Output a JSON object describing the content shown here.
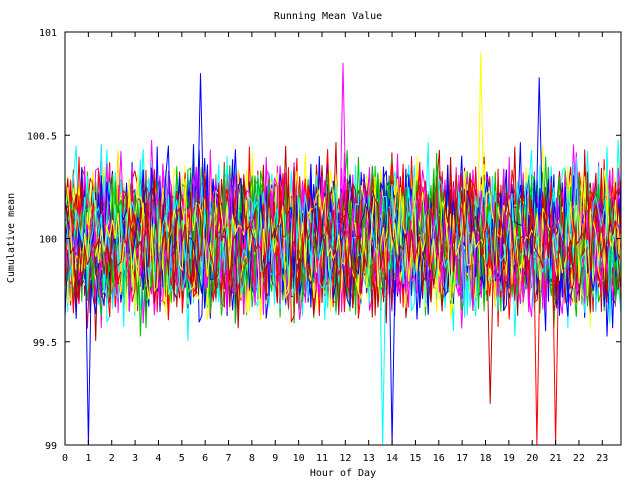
{
  "chart_data": {
    "type": "line",
    "title": "Running Mean Value",
    "xlabel": "Hour of Day",
    "ylabel": "Cumulative mean",
    "xlim": [
      0,
      23.8
    ],
    "ylim": [
      99,
      101
    ],
    "x_ticks": [
      "0",
      "1",
      "2",
      "3",
      "4",
      "5",
      "6",
      "7",
      "8",
      "9",
      "10",
      "11",
      "12",
      "13",
      "14",
      "15",
      "16",
      "17",
      "18",
      "19",
      "20",
      "21",
      "22",
      "23"
    ],
    "y_ticks": [
      "99",
      "99.5",
      "100",
      "100.5",
      "101"
    ],
    "grid": false,
    "legend": "none",
    "series_colors": [
      "#ff0000",
      "#00c000",
      "#0000ff",
      "#ff00ff",
      "#00ffff",
      "#ffff00",
      "#c00000"
    ],
    "series_count": 70,
    "points_per_series": 200,
    "center_value": 100,
    "typical_band": [
      99.6,
      100.4
    ],
    "notable_excursions": [
      {
        "x": 1.0,
        "y": 99.0,
        "color": "#0000ff"
      },
      {
        "x": 5.8,
        "y": 100.8,
        "color": "#0000ff"
      },
      {
        "x": 11.9,
        "y": 100.85,
        "color": "#ff00ff"
      },
      {
        "x": 13.6,
        "y": 99.0,
        "color": "#00ffff"
      },
      {
        "x": 14.0,
        "y": 99.0,
        "color": "#0000ff"
      },
      {
        "x": 17.8,
        "y": 100.9,
        "color": "#ffff00"
      },
      {
        "x": 18.2,
        "y": 99.2,
        "color": "#c00000"
      },
      {
        "x": 20.2,
        "y": 99.0,
        "color": "#ff0000"
      },
      {
        "x": 20.3,
        "y": 100.78,
        "color": "#0000ff"
      },
      {
        "x": 21.0,
        "y": 99.0,
        "color": "#ff0000"
      }
    ]
  }
}
